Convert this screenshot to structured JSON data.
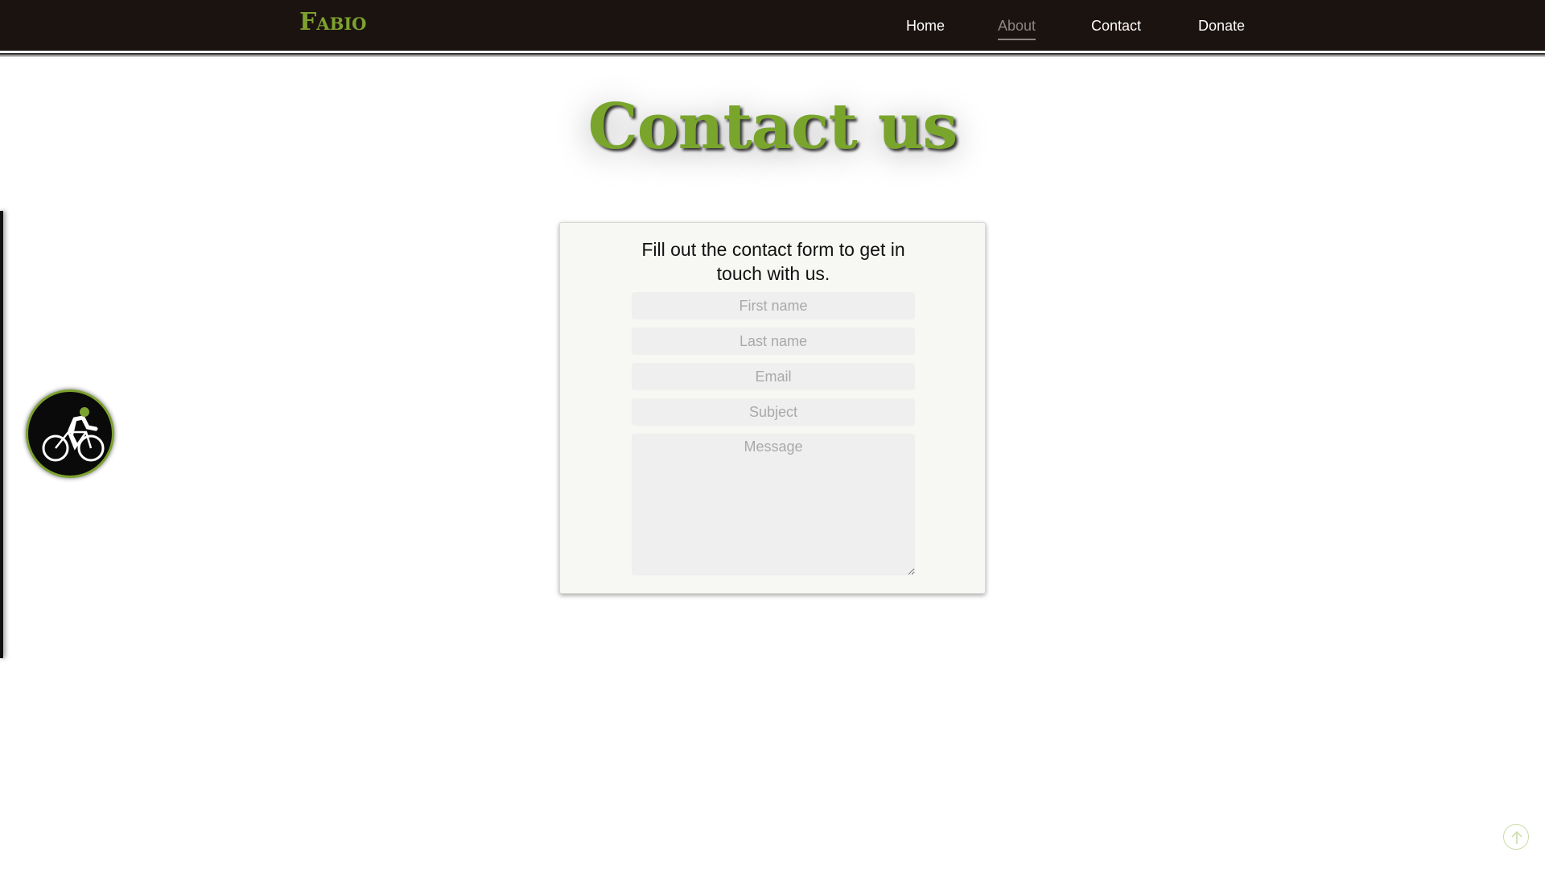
{
  "navbar": {
    "brand": "Fabio",
    "links": [
      {
        "label": "Home",
        "active": false
      },
      {
        "label": "About",
        "active": true
      },
      {
        "label": "Contact",
        "active": false
      },
      {
        "label": "Donate",
        "active": false
      }
    ]
  },
  "hero": {
    "title": "Contact us"
  },
  "form": {
    "intro": "Fill out the contact form to get in touch with us.",
    "first_name": {
      "placeholder": "First name",
      "value": ""
    },
    "last_name": {
      "placeholder": "Last name",
      "value": ""
    },
    "email": {
      "placeholder": "Email",
      "value": ""
    },
    "subject": {
      "placeholder": "Subject",
      "value": ""
    },
    "message": {
      "placeholder": "Message",
      "value": ""
    }
  },
  "icons": {
    "side_badge": "cyclist-icon",
    "scroll_top": "arrow-up-icon"
  },
  "colors": {
    "brand_green": "#7da22f",
    "navbar_bg": "#1b1310",
    "card_bg": "#f7f8f3",
    "field_bg": "#efefef"
  }
}
